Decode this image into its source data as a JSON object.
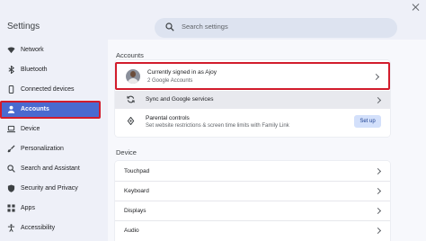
{
  "window": {
    "title": "Settings"
  },
  "search": {
    "placeholder": "Search settings"
  },
  "sidebar": {
    "items": [
      {
        "label": "Network",
        "icon": "wifi-icon"
      },
      {
        "label": "Bluetooth",
        "icon": "bluetooth-icon"
      },
      {
        "label": "Connected devices",
        "icon": "phone-icon"
      },
      {
        "label": "Accounts",
        "icon": "person-icon",
        "active": true
      },
      {
        "label": "Device",
        "icon": "laptop-icon"
      },
      {
        "label": "Personalization",
        "icon": "palette-icon"
      },
      {
        "label": "Search and Assistant",
        "icon": "search-icon"
      },
      {
        "label": "Security and Privacy",
        "icon": "shield-icon"
      },
      {
        "label": "Apps",
        "icon": "apps-grid-icon"
      },
      {
        "label": "Accessibility",
        "icon": "accessibility-icon"
      }
    ]
  },
  "accounts": {
    "section_title": "Accounts",
    "signed_in": {
      "title": "Currently signed in as Ajoy",
      "subtitle": "2 Google Accounts"
    },
    "sync": {
      "label": "Sync and Google services"
    },
    "parental": {
      "title": "Parental controls",
      "subtitle": "Set website restrictions & screen time limits with Family Link",
      "button": "Set up"
    }
  },
  "device": {
    "section_title": "Device",
    "items": [
      "Touchpad",
      "Keyboard",
      "Displays",
      "Audio"
    ]
  },
  "colors": {
    "accent": "#4a6ad0",
    "highlight_border": "#d21c2c",
    "button_bg": "#d3e0fb"
  }
}
